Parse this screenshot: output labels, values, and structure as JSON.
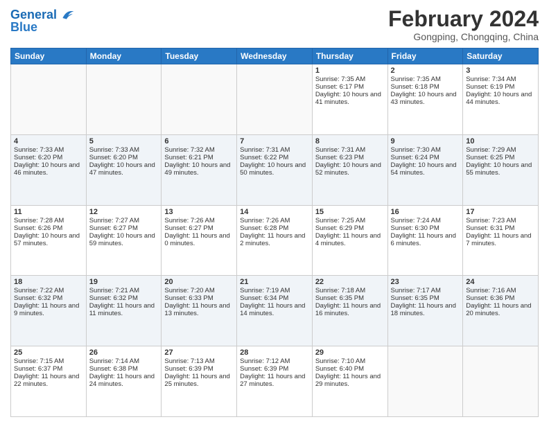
{
  "header": {
    "logo_line1": "General",
    "logo_line2": "Blue",
    "title": "February 2024",
    "location": "Gongping, Chongqing, China"
  },
  "days_of_week": [
    "Sunday",
    "Monday",
    "Tuesday",
    "Wednesday",
    "Thursday",
    "Friday",
    "Saturday"
  ],
  "weeks": [
    [
      {
        "day": "",
        "info": ""
      },
      {
        "day": "",
        "info": ""
      },
      {
        "day": "",
        "info": ""
      },
      {
        "day": "",
        "info": ""
      },
      {
        "day": "1",
        "info": "Sunrise: 7:35 AM\nSunset: 6:17 PM\nDaylight: 10 hours and 41 minutes."
      },
      {
        "day": "2",
        "info": "Sunrise: 7:35 AM\nSunset: 6:18 PM\nDaylight: 10 hours and 43 minutes."
      },
      {
        "day": "3",
        "info": "Sunrise: 7:34 AM\nSunset: 6:19 PM\nDaylight: 10 hours and 44 minutes."
      }
    ],
    [
      {
        "day": "4",
        "info": "Sunrise: 7:33 AM\nSunset: 6:20 PM\nDaylight: 10 hours and 46 minutes."
      },
      {
        "day": "5",
        "info": "Sunrise: 7:33 AM\nSunset: 6:20 PM\nDaylight: 10 hours and 47 minutes."
      },
      {
        "day": "6",
        "info": "Sunrise: 7:32 AM\nSunset: 6:21 PM\nDaylight: 10 hours and 49 minutes."
      },
      {
        "day": "7",
        "info": "Sunrise: 7:31 AM\nSunset: 6:22 PM\nDaylight: 10 hours and 50 minutes."
      },
      {
        "day": "8",
        "info": "Sunrise: 7:31 AM\nSunset: 6:23 PM\nDaylight: 10 hours and 52 minutes."
      },
      {
        "day": "9",
        "info": "Sunrise: 7:30 AM\nSunset: 6:24 PM\nDaylight: 10 hours and 54 minutes."
      },
      {
        "day": "10",
        "info": "Sunrise: 7:29 AM\nSunset: 6:25 PM\nDaylight: 10 hours and 55 minutes."
      }
    ],
    [
      {
        "day": "11",
        "info": "Sunrise: 7:28 AM\nSunset: 6:26 PM\nDaylight: 10 hours and 57 minutes."
      },
      {
        "day": "12",
        "info": "Sunrise: 7:27 AM\nSunset: 6:27 PM\nDaylight: 10 hours and 59 minutes."
      },
      {
        "day": "13",
        "info": "Sunrise: 7:26 AM\nSunset: 6:27 PM\nDaylight: 11 hours and 0 minutes."
      },
      {
        "day": "14",
        "info": "Sunrise: 7:26 AM\nSunset: 6:28 PM\nDaylight: 11 hours and 2 minutes."
      },
      {
        "day": "15",
        "info": "Sunrise: 7:25 AM\nSunset: 6:29 PM\nDaylight: 11 hours and 4 minutes."
      },
      {
        "day": "16",
        "info": "Sunrise: 7:24 AM\nSunset: 6:30 PM\nDaylight: 11 hours and 6 minutes."
      },
      {
        "day": "17",
        "info": "Sunrise: 7:23 AM\nSunset: 6:31 PM\nDaylight: 11 hours and 7 minutes."
      }
    ],
    [
      {
        "day": "18",
        "info": "Sunrise: 7:22 AM\nSunset: 6:32 PM\nDaylight: 11 hours and 9 minutes."
      },
      {
        "day": "19",
        "info": "Sunrise: 7:21 AM\nSunset: 6:32 PM\nDaylight: 11 hours and 11 minutes."
      },
      {
        "day": "20",
        "info": "Sunrise: 7:20 AM\nSunset: 6:33 PM\nDaylight: 11 hours and 13 minutes."
      },
      {
        "day": "21",
        "info": "Sunrise: 7:19 AM\nSunset: 6:34 PM\nDaylight: 11 hours and 14 minutes."
      },
      {
        "day": "22",
        "info": "Sunrise: 7:18 AM\nSunset: 6:35 PM\nDaylight: 11 hours and 16 minutes."
      },
      {
        "day": "23",
        "info": "Sunrise: 7:17 AM\nSunset: 6:35 PM\nDaylight: 11 hours and 18 minutes."
      },
      {
        "day": "24",
        "info": "Sunrise: 7:16 AM\nSunset: 6:36 PM\nDaylight: 11 hours and 20 minutes."
      }
    ],
    [
      {
        "day": "25",
        "info": "Sunrise: 7:15 AM\nSunset: 6:37 PM\nDaylight: 11 hours and 22 minutes."
      },
      {
        "day": "26",
        "info": "Sunrise: 7:14 AM\nSunset: 6:38 PM\nDaylight: 11 hours and 24 minutes."
      },
      {
        "day": "27",
        "info": "Sunrise: 7:13 AM\nSunset: 6:39 PM\nDaylight: 11 hours and 25 minutes."
      },
      {
        "day": "28",
        "info": "Sunrise: 7:12 AM\nSunset: 6:39 PM\nDaylight: 11 hours and 27 minutes."
      },
      {
        "day": "29",
        "info": "Sunrise: 7:10 AM\nSunset: 6:40 PM\nDaylight: 11 hours and 29 minutes."
      },
      {
        "day": "",
        "info": ""
      },
      {
        "day": "",
        "info": ""
      }
    ]
  ]
}
